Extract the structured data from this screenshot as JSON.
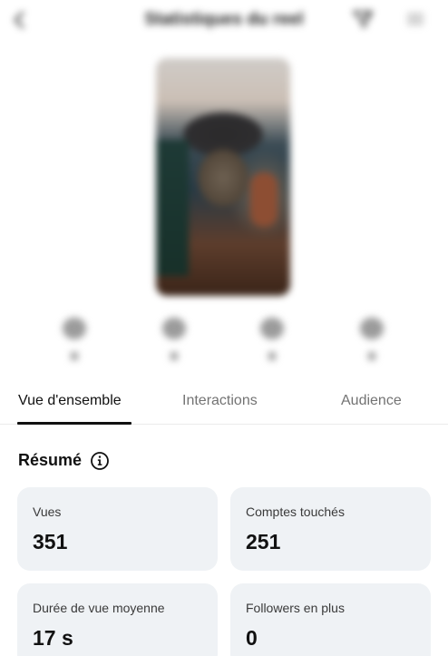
{
  "header": {
    "title": "Statistiques du reel",
    "back_icon": "chevron-left-icon",
    "share_icon": "share-icon",
    "more_icon": "more-icon"
  },
  "reel_stats": [
    {
      "icon": "heart-icon",
      "count": "7"
    },
    {
      "icon": "comment-icon",
      "count": "0"
    },
    {
      "icon": "send-icon",
      "count": "0"
    },
    {
      "icon": "bookmark-icon",
      "count": "0"
    }
  ],
  "tabs": [
    {
      "label": "Vue d'ensemble",
      "active": true
    },
    {
      "label": "Interactions",
      "active": false
    },
    {
      "label": "Audience",
      "active": false
    }
  ],
  "summary": {
    "title": "Résumé",
    "info_icon": "info-icon",
    "cards": [
      {
        "label": "Vues",
        "value": "351"
      },
      {
        "label": "Comptes touchés",
        "value": "251"
      },
      {
        "label": "Durée de vue moyenne",
        "value": "17 s"
      },
      {
        "label": "Followers en plus",
        "value": "0"
      }
    ]
  },
  "colors": {
    "card_background": "#eff2f5",
    "active_tab": "#111111",
    "inactive_tab": "#737373"
  }
}
